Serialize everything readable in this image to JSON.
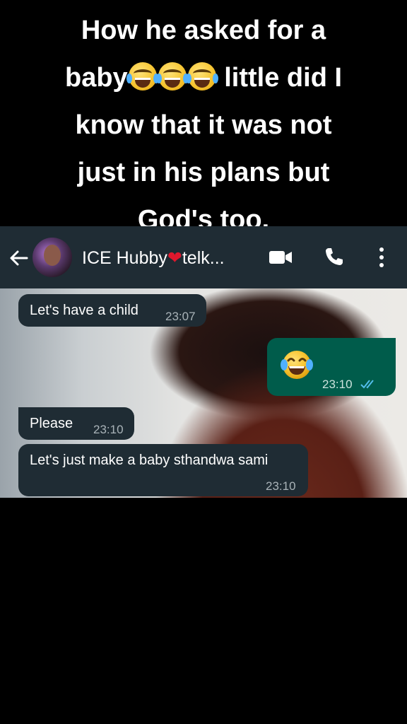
{
  "caption": {
    "line1": "How he asked for a",
    "line2_a": "baby",
    "line2_b": " little did I",
    "line3": "know that it was not",
    "line4": "just in his plans but",
    "line5": "God's too."
  },
  "header": {
    "contact_name_a": "ICE Hubby",
    "contact_name_heart": "❤",
    "contact_name_b": "telk..."
  },
  "messages": [
    {
      "direction": "incoming",
      "text": "Let's have a child",
      "time": "23:07"
    },
    {
      "direction": "outgoing",
      "emoji": "face-with-tears-of-joy",
      "time": "23:10",
      "status": "read"
    },
    {
      "direction": "incoming",
      "text": "Please",
      "time": "23:10"
    },
    {
      "direction": "incoming",
      "text": "Let's just make a baby sthandwa sami",
      "time": "23:10"
    }
  ],
  "colors": {
    "header_bg": "#1f2c34",
    "incoming_bubble": "#1f2c34",
    "outgoing_bubble": "#005c4b",
    "read_ticks": "#53bdeb"
  }
}
